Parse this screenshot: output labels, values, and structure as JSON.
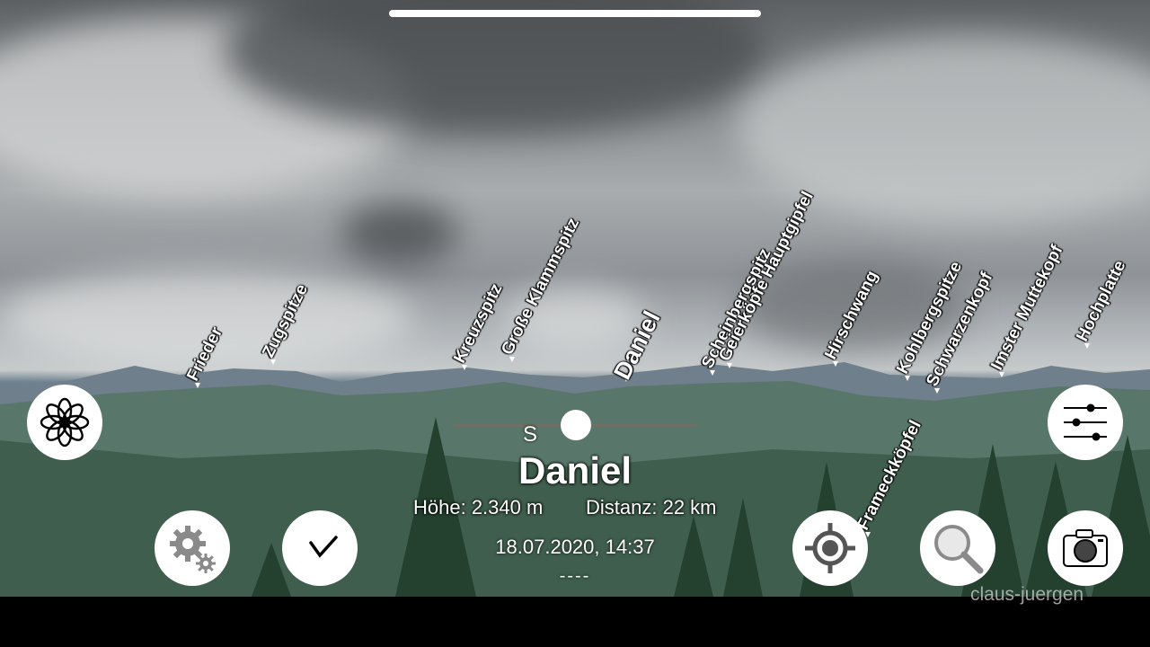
{
  "peaks": [
    {
      "label": "Frieder",
      "big": false
    },
    {
      "label": "Zugspitze",
      "big": false
    },
    {
      "label": "Kreuzspitz",
      "big": false
    },
    {
      "label": "Große Klammspitz",
      "big": false
    },
    {
      "label": "Daniel",
      "big": true
    },
    {
      "label": "Scheinbergspitz",
      "big": false
    },
    {
      "label": "Geierköpfe Hauptgipfel",
      "big": false
    },
    {
      "label": "Hirschwang",
      "big": false
    },
    {
      "label": "Kohlbergspitze",
      "big": false
    },
    {
      "label": "Schwarzenkopf",
      "big": false
    },
    {
      "label": "Imster Muttekopf",
      "big": false
    },
    {
      "label": "Hochplatte",
      "big": false
    },
    {
      "label": "Frameckköpfel",
      "big": false
    }
  ],
  "compass": {
    "letter": "S"
  },
  "selected": {
    "name": "Daniel",
    "height": "Höhe: 2.340 m",
    "distance": "Distanz: 22 km",
    "datetime": "18.07.2020, 14:37",
    "extra": "----"
  },
  "buttons": {
    "menu": "flower-icon",
    "settings": "gear-icon",
    "time": "clock-icon",
    "filter": "sliders-icon",
    "locate": "crosshair-icon",
    "search": "magnifier-icon",
    "camera": "camera-icon"
  },
  "watermark": "claus-juergen"
}
